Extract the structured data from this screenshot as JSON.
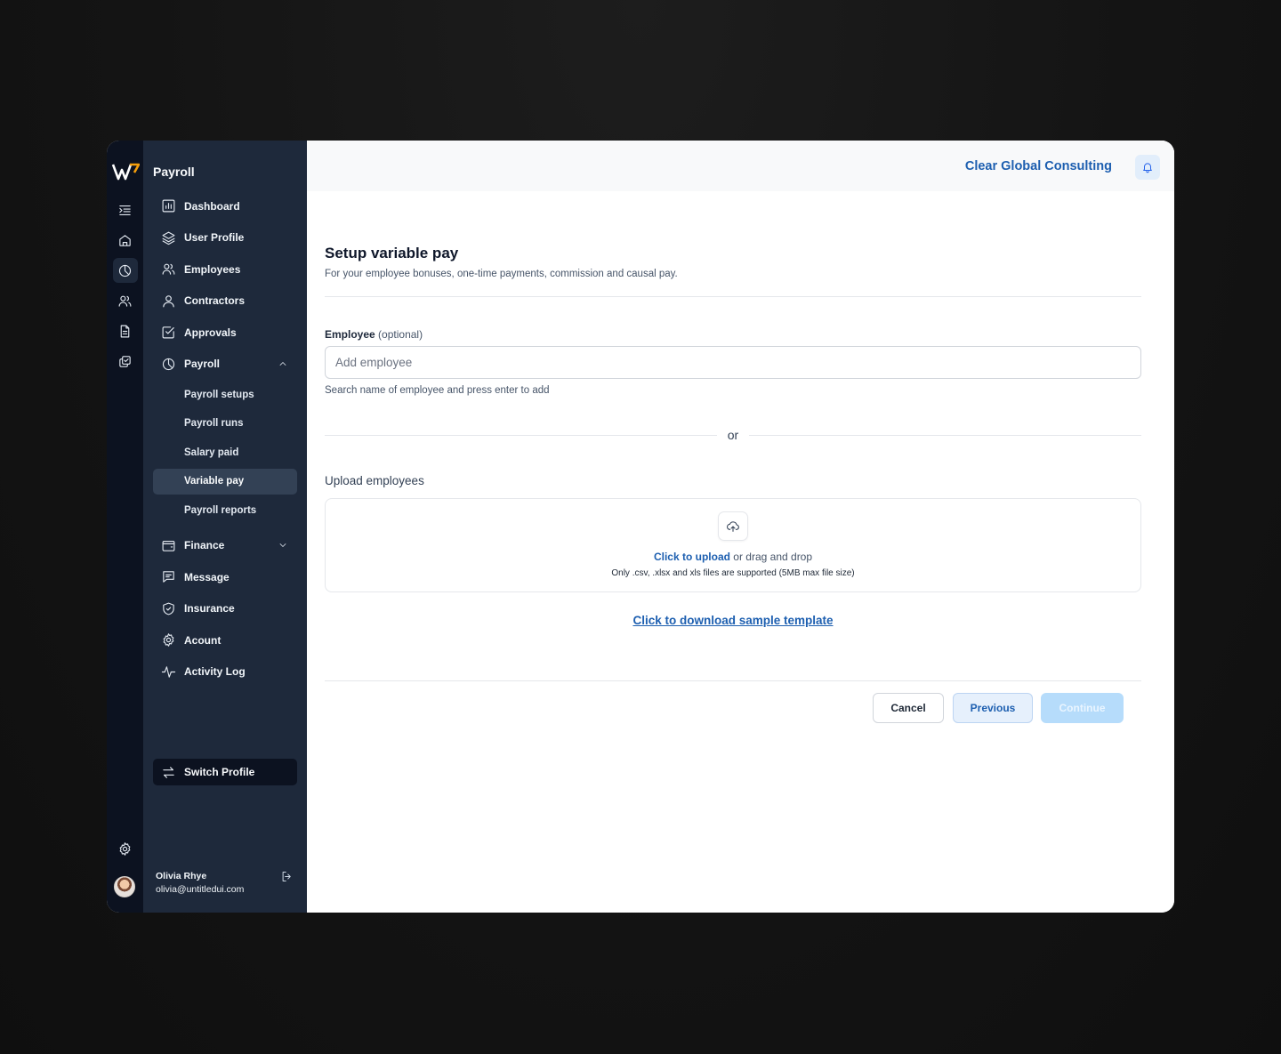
{
  "sidebar": {
    "brand": "Payroll",
    "nav": {
      "dashboard": "Dashboard",
      "user_profile": "User Profile",
      "employees": "Employees",
      "contractors": "Contractors",
      "approvals": "Approvals",
      "payroll": "Payroll",
      "payroll_sub": [
        "Payroll setups",
        "Payroll runs",
        "Salary paid",
        "Variable pay",
        "Payroll reports"
      ],
      "finance": "Finance",
      "message": "Message",
      "insurance": "Insurance",
      "account": "Acount",
      "activity_log": "Activity Log"
    },
    "active_item": "Variable pay",
    "switch_profile": "Switch Profile",
    "user": {
      "name": "Olivia Rhye",
      "email": "olivia@untitledui.com"
    }
  },
  "header": {
    "org_name": "Clear Global Consulting"
  },
  "page": {
    "title": "Setup variable pay",
    "subtitle": "For your employee bonuses, one-time payments, commission and causal pay.",
    "employee_label": "Employee",
    "employee_optional": "(optional)",
    "employee_placeholder": "Add employee",
    "employee_hint": "Search name of employee and press enter to add",
    "or": "or",
    "upload_label": "Upload employees",
    "upload_click": "Click to upload",
    "upload_drag": " or drag and drop",
    "upload_note": "Only .csv, .xlsx and xls files are supported (5MB max file size)",
    "sample_link": "Click to download sample template"
  },
  "buttons": {
    "cancel": "Cancel",
    "previous": "Previous",
    "continue": "Continue"
  },
  "colors": {
    "accent": "#1d5fb0",
    "sidebar": "#1e293b",
    "rail": "#0c1220",
    "continue_disabled": "#b6dcfb"
  }
}
